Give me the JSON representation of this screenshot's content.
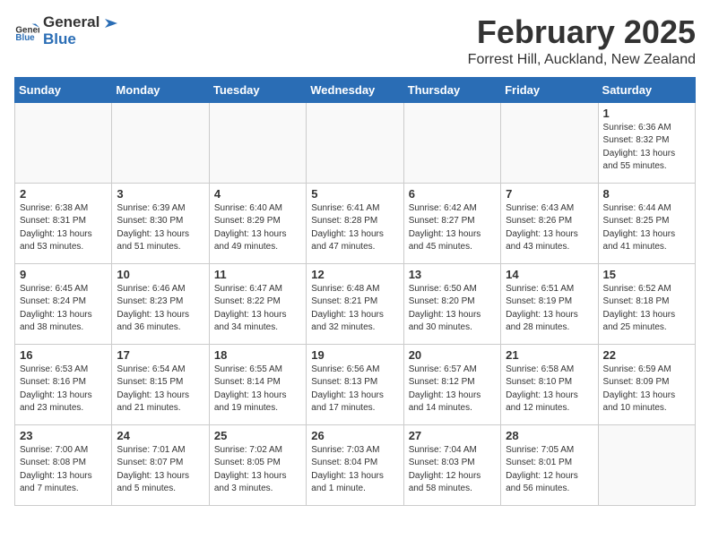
{
  "header": {
    "logo_general": "General",
    "logo_blue": "Blue",
    "month_year": "February 2025",
    "location": "Forrest Hill, Auckland, New Zealand"
  },
  "weekdays": [
    "Sunday",
    "Monday",
    "Tuesday",
    "Wednesday",
    "Thursday",
    "Friday",
    "Saturday"
  ],
  "weeks": [
    [
      {
        "day": "",
        "info": ""
      },
      {
        "day": "",
        "info": ""
      },
      {
        "day": "",
        "info": ""
      },
      {
        "day": "",
        "info": ""
      },
      {
        "day": "",
        "info": ""
      },
      {
        "day": "",
        "info": ""
      },
      {
        "day": "1",
        "info": "Sunrise: 6:36 AM\nSunset: 8:32 PM\nDaylight: 13 hours\nand 55 minutes."
      }
    ],
    [
      {
        "day": "2",
        "info": "Sunrise: 6:38 AM\nSunset: 8:31 PM\nDaylight: 13 hours\nand 53 minutes."
      },
      {
        "day": "3",
        "info": "Sunrise: 6:39 AM\nSunset: 8:30 PM\nDaylight: 13 hours\nand 51 minutes."
      },
      {
        "day": "4",
        "info": "Sunrise: 6:40 AM\nSunset: 8:29 PM\nDaylight: 13 hours\nand 49 minutes."
      },
      {
        "day": "5",
        "info": "Sunrise: 6:41 AM\nSunset: 8:28 PM\nDaylight: 13 hours\nand 47 minutes."
      },
      {
        "day": "6",
        "info": "Sunrise: 6:42 AM\nSunset: 8:27 PM\nDaylight: 13 hours\nand 45 minutes."
      },
      {
        "day": "7",
        "info": "Sunrise: 6:43 AM\nSunset: 8:26 PM\nDaylight: 13 hours\nand 43 minutes."
      },
      {
        "day": "8",
        "info": "Sunrise: 6:44 AM\nSunset: 8:25 PM\nDaylight: 13 hours\nand 41 minutes."
      }
    ],
    [
      {
        "day": "9",
        "info": "Sunrise: 6:45 AM\nSunset: 8:24 PM\nDaylight: 13 hours\nand 38 minutes."
      },
      {
        "day": "10",
        "info": "Sunrise: 6:46 AM\nSunset: 8:23 PM\nDaylight: 13 hours\nand 36 minutes."
      },
      {
        "day": "11",
        "info": "Sunrise: 6:47 AM\nSunset: 8:22 PM\nDaylight: 13 hours\nand 34 minutes."
      },
      {
        "day": "12",
        "info": "Sunrise: 6:48 AM\nSunset: 8:21 PM\nDaylight: 13 hours\nand 32 minutes."
      },
      {
        "day": "13",
        "info": "Sunrise: 6:50 AM\nSunset: 8:20 PM\nDaylight: 13 hours\nand 30 minutes."
      },
      {
        "day": "14",
        "info": "Sunrise: 6:51 AM\nSunset: 8:19 PM\nDaylight: 13 hours\nand 28 minutes."
      },
      {
        "day": "15",
        "info": "Sunrise: 6:52 AM\nSunset: 8:18 PM\nDaylight: 13 hours\nand 25 minutes."
      }
    ],
    [
      {
        "day": "16",
        "info": "Sunrise: 6:53 AM\nSunset: 8:16 PM\nDaylight: 13 hours\nand 23 minutes."
      },
      {
        "day": "17",
        "info": "Sunrise: 6:54 AM\nSunset: 8:15 PM\nDaylight: 13 hours\nand 21 minutes."
      },
      {
        "day": "18",
        "info": "Sunrise: 6:55 AM\nSunset: 8:14 PM\nDaylight: 13 hours\nand 19 minutes."
      },
      {
        "day": "19",
        "info": "Sunrise: 6:56 AM\nSunset: 8:13 PM\nDaylight: 13 hours\nand 17 minutes."
      },
      {
        "day": "20",
        "info": "Sunrise: 6:57 AM\nSunset: 8:12 PM\nDaylight: 13 hours\nand 14 minutes."
      },
      {
        "day": "21",
        "info": "Sunrise: 6:58 AM\nSunset: 8:10 PM\nDaylight: 13 hours\nand 12 minutes."
      },
      {
        "day": "22",
        "info": "Sunrise: 6:59 AM\nSunset: 8:09 PM\nDaylight: 13 hours\nand 10 minutes."
      }
    ],
    [
      {
        "day": "23",
        "info": "Sunrise: 7:00 AM\nSunset: 8:08 PM\nDaylight: 13 hours\nand 7 minutes."
      },
      {
        "day": "24",
        "info": "Sunrise: 7:01 AM\nSunset: 8:07 PM\nDaylight: 13 hours\nand 5 minutes."
      },
      {
        "day": "25",
        "info": "Sunrise: 7:02 AM\nSunset: 8:05 PM\nDaylight: 13 hours\nand 3 minutes."
      },
      {
        "day": "26",
        "info": "Sunrise: 7:03 AM\nSunset: 8:04 PM\nDaylight: 13 hours\nand 1 minute."
      },
      {
        "day": "27",
        "info": "Sunrise: 7:04 AM\nSunset: 8:03 PM\nDaylight: 12 hours\nand 58 minutes."
      },
      {
        "day": "28",
        "info": "Sunrise: 7:05 AM\nSunset: 8:01 PM\nDaylight: 12 hours\nand 56 minutes."
      },
      {
        "day": "",
        "info": ""
      }
    ]
  ]
}
